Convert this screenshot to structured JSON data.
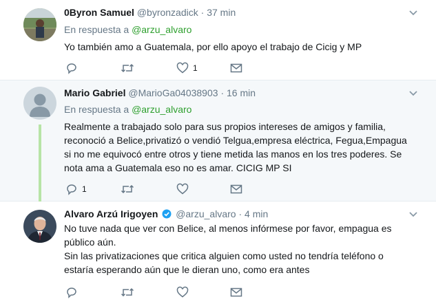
{
  "tweets": [
    {
      "name": "0Byron Samuel",
      "handle": "@byronzadick",
      "dot": "·",
      "time": "37 min",
      "reply_prefix": "En respuesta a",
      "reply_mention": "@arzu_alvaro",
      "text_lines": [
        "Yo también amo a Guatemala, por ello apoyo el trabajo de Cicig y MP"
      ],
      "reply_count": "",
      "retweet_count": "",
      "like_count": "1"
    },
    {
      "name": "Mario Gabriel",
      "handle": "@MarioGa04038903",
      "dot": "·",
      "time": "16 min",
      "reply_prefix": "En respuesta a",
      "reply_mention": "@arzu_alvaro",
      "text_lines": [
        "Realmente a trabajado solo para sus propios intereses de amigos y familia,",
        "reconoció a Belice,privatizó o vendió Telgua,empresa eléctrica, Fegua,Empagua",
        "si no me equivocó entre otros y tiene metida las manos en los tres poderes. Se",
        "nota ama a Guatemala eso no es amar. CICIG MP SI"
      ],
      "reply_count": "1",
      "retweet_count": "",
      "like_count": ""
    },
    {
      "name": "Alvaro Arzú Irigoyen",
      "handle": "@arzu_alvaro",
      "dot": "·",
      "time": "4 min",
      "verified": true,
      "text_lines": [
        "No tuve nada que ver con Belice, al menos infórmese por favor, empagua es",
        "público aún.",
        "Sin las privatizaciones que critica alguien como usted no tendría teléfono o",
        "estaría esperando aún que le dieran uno, como era antes"
      ],
      "reply_count": "",
      "retweet_count": "",
      "like_count": ""
    }
  ],
  "colors": {
    "accent_green": "#2d9f2d",
    "muted": "#657786",
    "thread_line": "#b7e4a6",
    "verified_blue": "#1da1f2"
  },
  "icons": [
    "reply-icon",
    "retweet-icon",
    "like-icon",
    "message-icon",
    "caret-down-icon",
    "verified-icon"
  ]
}
